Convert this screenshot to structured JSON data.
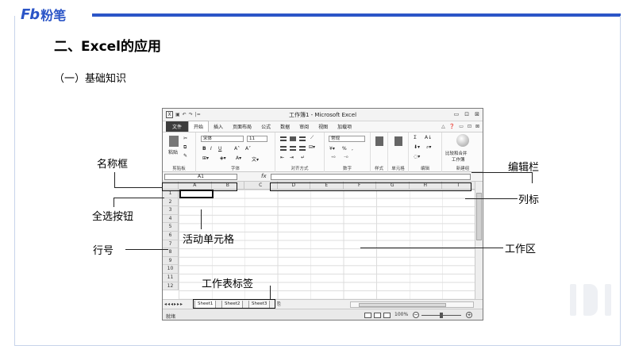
{
  "brand": {
    "logo_mark": "Fb",
    "logo_text": "粉笔"
  },
  "slide": {
    "heading": "二、Excel的应用",
    "subheading": "（一）基础知识"
  },
  "excel": {
    "title": "工作簿1 - Microsoft Excel",
    "qat": [
      "▣",
      "↶",
      "↷",
      "|="
    ],
    "window_controls": [
      "▭",
      "⊡",
      "⊠"
    ],
    "tabs": [
      "文件",
      "开始",
      "插入",
      "页面布局",
      "公式",
      "数据",
      "审阅",
      "视图",
      "加载项"
    ],
    "active_tab": "开始",
    "tab_right": [
      "△",
      "❓",
      "▭",
      "⊡",
      "⊠"
    ],
    "ribbon": {
      "clipboard": {
        "label": "剪贴板",
        "paste": "粘贴"
      },
      "font": {
        "label": "字体",
        "font_name": "宋体",
        "font_size": "11",
        "bold": "B",
        "italic": "I",
        "underline": "U",
        "grow": "A˄",
        "shrink": "A˅"
      },
      "alignment": {
        "label": "对齐方式"
      },
      "number": {
        "label": "数字",
        "format": "常规",
        "percent": "%",
        "comma": ","
      },
      "styles": {
        "label": "样式"
      },
      "cells": {
        "label": "单元格"
      },
      "editing": {
        "label": "编辑",
        "sum": "Σ",
        "sort": "A↓"
      },
      "new_group": {
        "label": "新建组",
        "merge": "比较和合并",
        "merge2": "工作簿"
      }
    },
    "name_box": "A1",
    "fx": "fx",
    "columns": [
      "A",
      "B",
      "C",
      "D",
      "E",
      "F",
      "G",
      "H",
      "I"
    ],
    "rows": [
      "1",
      "2",
      "3",
      "4",
      "5",
      "6",
      "7",
      "8",
      "9",
      "10",
      "11",
      "12"
    ],
    "sheet_nav": "◂◂◂▸▸▸",
    "sheets": [
      "Sheet1",
      "Sheet2",
      "Sheet3"
    ],
    "status": "就绪",
    "zoom": "100%"
  },
  "callouts": {
    "name_box": "名称框",
    "select_all": "全选按钮",
    "active_cell": "活动单元格",
    "row_number": "行号",
    "sheet_tabs": "工作表标签",
    "edit_bar": "编辑栏",
    "column_label": "列标",
    "work_area": "工作区"
  }
}
